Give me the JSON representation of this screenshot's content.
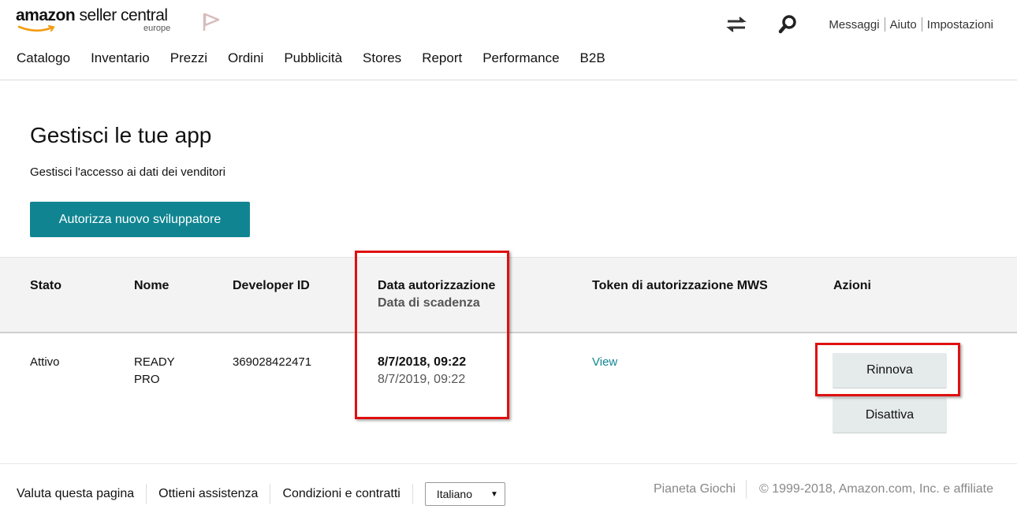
{
  "header": {
    "logo_brand": "amazon",
    "logo_product": "seller central",
    "logo_region": "europe",
    "top_links": [
      "Messaggi",
      "Aiuto",
      "Impostazioni"
    ],
    "nav": [
      "Catalogo",
      "Inventario",
      "Prezzi",
      "Ordini",
      "Pubblicità",
      "Stores",
      "Report",
      "Performance",
      "B2B"
    ]
  },
  "main": {
    "title": "Gestisci le tue app",
    "subtitle": "Gestisci l'accesso ai dati dei venditori",
    "authorize_button": "Autorizza nuovo sviluppatore"
  },
  "table": {
    "headers": {
      "status": "Stato",
      "name": "Nome",
      "developer_id": "Developer ID",
      "auth_date": "Data autorizzazione",
      "expiry_date": "Data di scadenza",
      "token": "Token di autorizzazione MWS",
      "actions": "Azioni"
    },
    "rows": [
      {
        "status": "Attivo",
        "name_line1": "READY",
        "name_line2": "PRO",
        "developer_id": "369028422471",
        "auth_date": "8/7/2018, 09:22",
        "expiry_date": "8/7/2019, 09:22",
        "token_link": "View",
        "renew_button": "Rinnova",
        "deactivate_button": "Disattiva"
      }
    ]
  },
  "footer": {
    "links": [
      "Valuta questa pagina",
      "Ottieni assistenza",
      "Condizioni e contratti"
    ],
    "language_selected": "Italiano",
    "store_name": "Pianeta Giochi",
    "copyright": "© 1999-2018, Amazon.com, Inc. e affiliate"
  },
  "colors": {
    "primary": "#108591",
    "highlight_box": "#e01010",
    "header_bg": "#f3f3f3"
  }
}
